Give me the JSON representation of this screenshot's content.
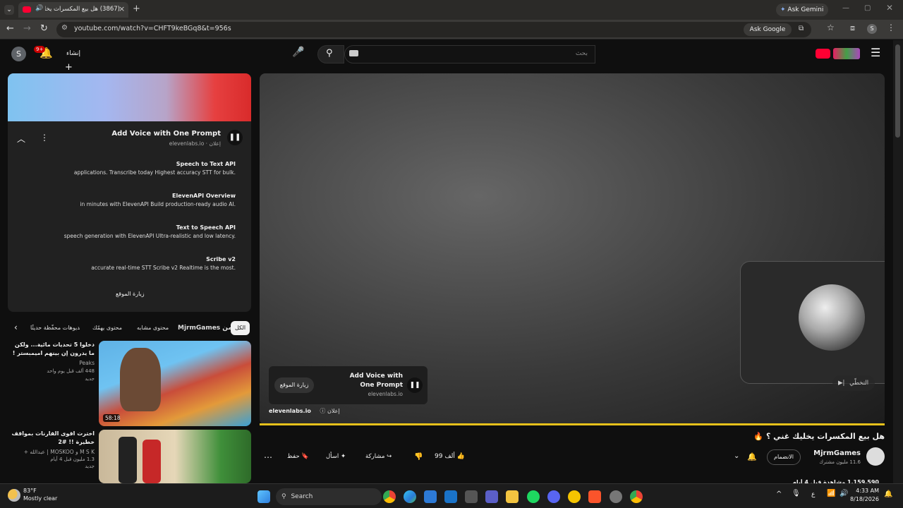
{
  "browser": {
    "tab_title": "(3867) هل بيع المكسرات يخلـ",
    "ask_gemini": "Ask Gemini",
    "url": "youtube.com/watch?v=CHFT9keBGq8&t=956s",
    "ask_google": "Ask Google"
  },
  "header": {
    "search_placeholder": "بحث",
    "create_label": "إنشاء",
    "notif_count": "9+",
    "avatar_letter": "S"
  },
  "ad_panel": {
    "title": "Add Voice with One Prompt",
    "sponsor": "إعلان · elevenlabs.io",
    "items": [
      {
        "title": "Speech to Text API",
        "desc": "applications. Transcribe today Highest accuracy STT for bulk."
      },
      {
        "title": "ElevenAPI Overview",
        "desc": "in minutes with ElevenAPI Build production-ready audio AI."
      },
      {
        "title": "Text to Speech API",
        "desc": "speech generation with ElevenAPI Ultra-realistic and low latency."
      },
      {
        "title": "Scribe v2",
        "desc": "accurate real-time STT Scribe v2 Realtime is the most."
      }
    ],
    "visit_site": "زيارة الموقع"
  },
  "chips": [
    "الكل",
    "من MjrmGames",
    "محتوى مشابه",
    "محتوى يهمّك",
    "فيديوهات محفّظة حديثًا"
  ],
  "recommendations": [
    {
      "title": "دخلوا 5 تحديات مائية... ولكن ما يدرون إن بينهم اميمبستر !",
      "channel": "Peaks",
      "views": "448 ألف",
      "age": "قبل يوم واحد",
      "badge": "جديد",
      "duration": "58:18"
    },
    {
      "title": "اخترت اقوى الفارنات بمواقف خطيرة !! #2",
      "channel": "M S K و MOSKOO | عبدالله +",
      "views": "1.3 مليون",
      "age": "قبل 4 أيام",
      "badge": "جديد",
      "duration": ""
    }
  ],
  "player_ad": {
    "title": "Add Voice with One Prompt",
    "domain": "elevenlabs.io",
    "visit": "زيارة الموقع",
    "sponsor_label": "إعلان",
    "sponsor_domain": "elevenlabs.io",
    "skip": "التخطّي"
  },
  "video": {
    "title": "هل بيع المكسرات يخليك غني ؟",
    "channel": "MjrmGames",
    "subscribers": "11.6 مليون مشترك",
    "join": "الانضمام",
    "likes": "99 ألف",
    "share": "مشاركة",
    "ask": "اسأل",
    "save": "حفظ",
    "views_line": "1,159,590 مشاهدة قبل 4 أيام"
  },
  "taskbar": {
    "weather_temp": "83°F",
    "weather_desc": "Mostly clear",
    "search": "Search",
    "time": "4:33 AM",
    "date": "8/18/2026",
    "lang": "ع"
  },
  "colors": {
    "accent_red": "#ff0033",
    "progress": "#e6c11b"
  }
}
